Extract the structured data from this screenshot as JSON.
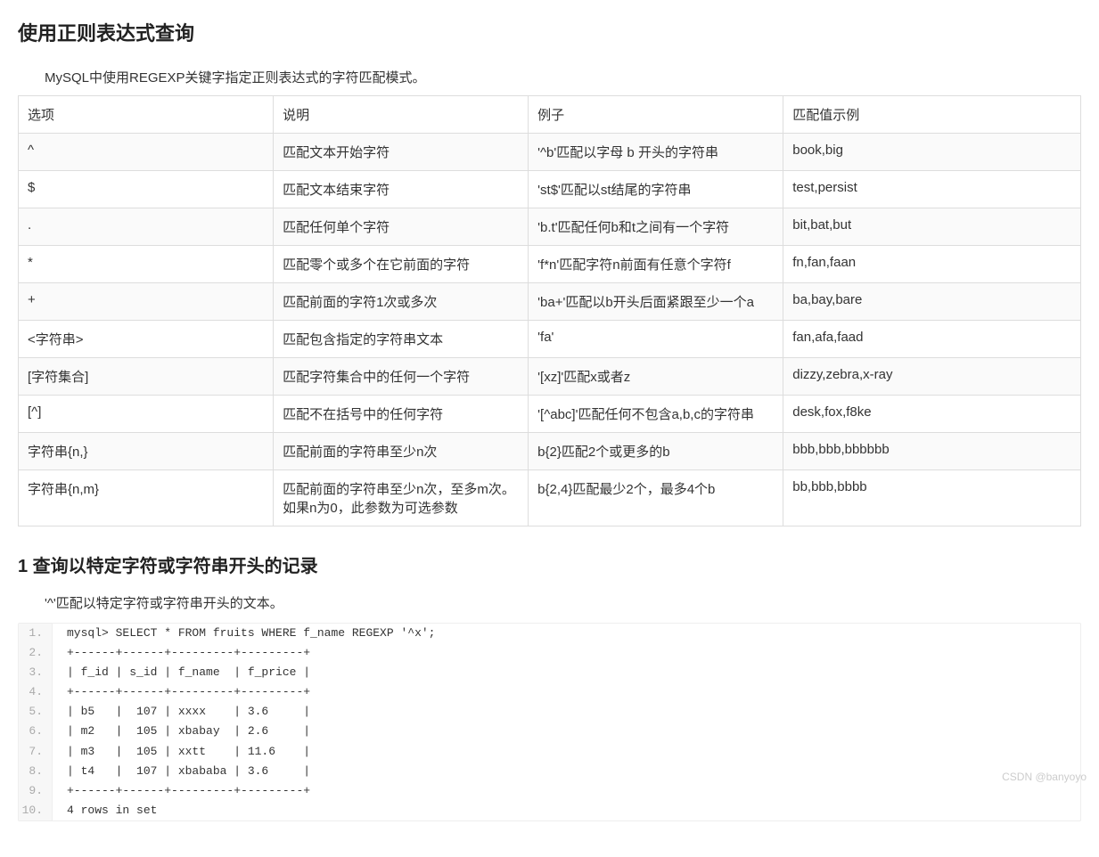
{
  "title": "使用正则表达式查询",
  "intro": "MySQL中使用REGEXP关键字指定正则表达式的字符匹配模式。",
  "table": {
    "headers": [
      "选项",
      "说明",
      "例子",
      "匹配值示例"
    ],
    "rows": [
      [
        "^",
        "匹配文本开始字符",
        "'^b'匹配以字母 b 开头的字符串",
        "book,big"
      ],
      [
        "$",
        "匹配文本结束字符",
        "'st$'匹配以st结尾的字符串",
        "test,persist"
      ],
      [
        ".",
        "匹配任何单个字符",
        "'b.t'匹配任何b和t之间有一个字符",
        "bit,bat,but"
      ],
      [
        "*",
        "匹配零个或多个在它前面的字符",
        "'f*n'匹配字符n前面有任意个字符f",
        "fn,fan,faan"
      ],
      [
        "+",
        "匹配前面的字符1次或多次",
        "'ba+'匹配以b开头后面紧跟至少一个a",
        "ba,bay,bare"
      ],
      [
        "<字符串>",
        "匹配包含指定的字符串文本",
        "'fa'",
        "fan,afa,faad"
      ],
      [
        "[字符集合]",
        "匹配字符集合中的任何一个字符",
        "'[xz]'匹配x或者z",
        "dizzy,zebra,x-ray"
      ],
      [
        "[^]",
        "匹配不在括号中的任何字符",
        "'[^abc]'匹配任何不包含a,b,c的字符串",
        "desk,fox,f8ke"
      ],
      [
        "字符串{n,}",
        "匹配前面的字符串至少n次",
        "b{2}匹配2个或更多的b",
        "bbb,bbb,bbbbbb"
      ],
      [
        "字符串{n,m}",
        "匹配前面的字符串至少n次，至多m次。如果n为0，此参数为可选参数",
        "b{2,4}匹配最少2个，最多4个b",
        "bb,bbb,bbbb"
      ]
    ]
  },
  "section1": {
    "heading": "1 查询以特定字符或字符串开头的记录",
    "intro": "'^'匹配以特定字符或字符串开头的文本。",
    "code": [
      "mysql> SELECT * FROM fruits WHERE f_name REGEXP '^x';",
      "+------+------+---------+---------+",
      "| f_id | s_id | f_name  | f_price |",
      "+------+------+---------+---------+",
      "| b5   |  107 | xxxx    | 3.6     |",
      "| m2   |  105 | xbabay  | 2.6     |",
      "| m3   |  105 | xxtt    | 11.6    |",
      "| t4   |  107 | xbababa | 3.6     |",
      "+------+------+---------+---------+",
      "4 rows in set"
    ]
  },
  "watermark": "CSDN @banyoyo"
}
